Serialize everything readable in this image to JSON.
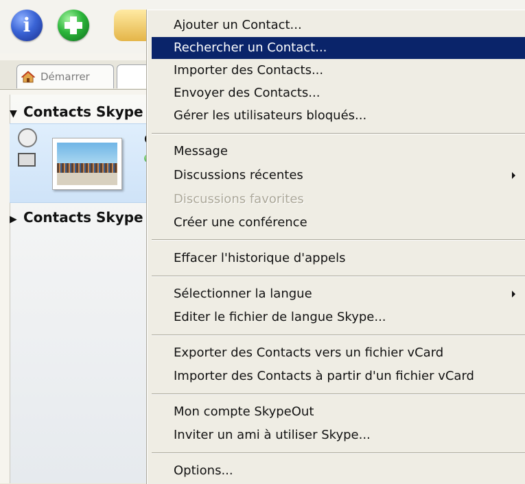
{
  "toolbar": {
    "info_glyph": "i",
    "buttons": [
      "info-icon",
      "add-contact-icon",
      "contacts-icon"
    ]
  },
  "tabs": {
    "start": "Démarrer"
  },
  "contacts": {
    "group1": "Contacts Skype",
    "group2": "Contacts Skype",
    "contact_initial": "G"
  },
  "menu": {
    "items": [
      {
        "label": "Ajouter un Contact..."
      },
      {
        "label": "Rechercher un Contact...",
        "selected": true
      },
      {
        "label": "Importer des Contacts..."
      },
      {
        "label": "Envoyer des Contacts..."
      },
      {
        "label": "Gérer les utilisateurs bloqués..."
      },
      {
        "label": "Message"
      },
      {
        "label": "Discussions récentes",
        "submenu": true
      },
      {
        "label": "Discussions favorites",
        "disabled": true
      },
      {
        "label": "Créer une conférence"
      },
      {
        "label": "Effacer l'historique d'appels"
      },
      {
        "label": "Sélectionner la langue",
        "submenu": true
      },
      {
        "label": "Editer le fichier de langue Skype..."
      },
      {
        "label": "Exporter des Contacts vers un fichier vCard"
      },
      {
        "label": "Importer des Contacts à partir d'un fichier vCard"
      },
      {
        "label": "Mon compte SkypeOut"
      },
      {
        "label": "Inviter un ami à utiliser Skype..."
      },
      {
        "label": "Options..."
      }
    ]
  },
  "colors": {
    "menu_bg": "#efede4",
    "selection": "#0a246a",
    "disabled_text": "#aca899"
  }
}
